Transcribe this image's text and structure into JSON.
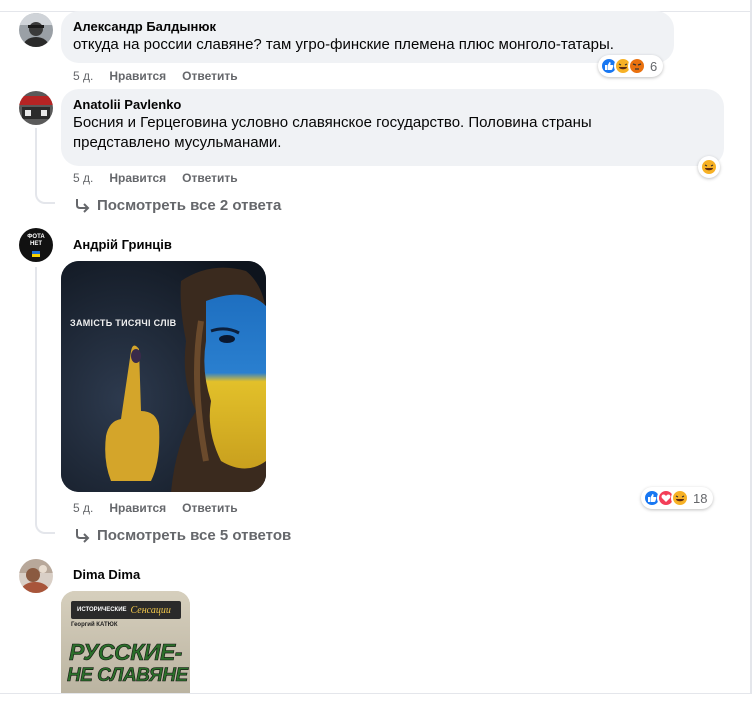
{
  "comments": [
    {
      "author": "Александр Балдынюк",
      "text": "откуда на россии славяне? там угро-финские племена плюс монголо-татары.",
      "time": "5 д.",
      "like": "Нравится",
      "reply": "Ответить",
      "reaction_count": "6"
    },
    {
      "author": "Anatolii Pavlenko",
      "text_lines": [
        "Босния и Герцеговина условно славянское государство. Половина страны",
        "представлено мусульманами."
      ],
      "time": "5 д.",
      "like": "Нравится",
      "reply": "Ответить",
      "view_replies": "Посмотреть все 2 ответа"
    },
    {
      "author": "Андрій Гринців",
      "avatar_text": [
        "ФОТА",
        "НЕТ"
      ],
      "image_caption": "ЗАМІСТЬ ТИСЯЧІ СЛІВ",
      "time": "5 д.",
      "like": "Нравится",
      "reply": "Ответить",
      "reaction_count": "18",
      "view_replies": "Посмотреть все 5 ответов"
    },
    {
      "author": "Dima Dima",
      "book": {
        "series": "ИСТОРИЧЕСКИЕ",
        "series_script": "Сенсации",
        "author": "Георгий КАТЮК",
        "title_line1": "РУССКИЕ-",
        "title_line2": "НЕ СЛАВЯНЕ"
      }
    }
  ],
  "colors": {
    "like_blue": "#1877f2",
    "love_red": "#f33e58",
    "haha_yellow": "#f7b125",
    "angry_orange": "#e9710f",
    "meta_gray": "#65676b",
    "bubble_bg": "#f0f2f5"
  }
}
